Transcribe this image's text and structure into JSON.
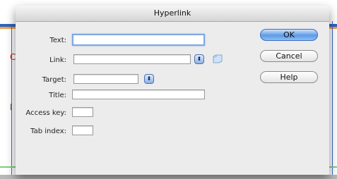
{
  "dialog": {
    "title": "Hyperlink",
    "labels": {
      "text": "Text:",
      "link": "Link:",
      "target": "Target:",
      "title": "Title:",
      "access_key": "Access key:",
      "tab_index": "Tab index:"
    },
    "fields": {
      "text": "",
      "link": "",
      "target": "",
      "title": "",
      "access_key": "",
      "tab_index": ""
    },
    "buttons": {
      "ok": "OK",
      "cancel": "Cancel",
      "help": "Help"
    }
  },
  "background": {
    "marks": [
      "C",
      "["
    ]
  }
}
